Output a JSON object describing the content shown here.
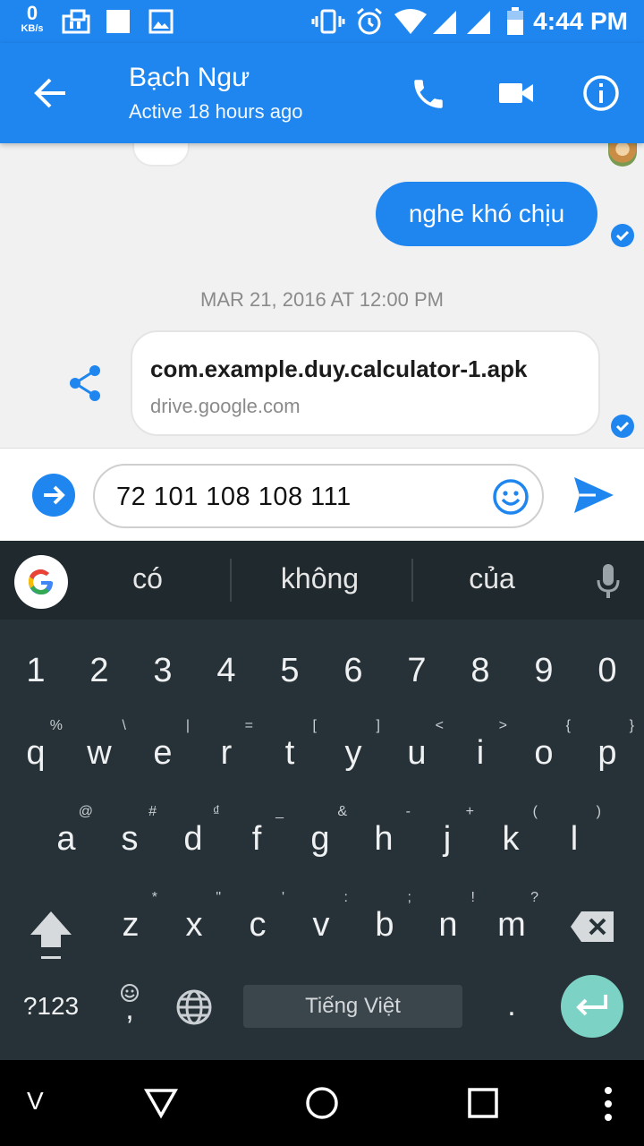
{
  "status_bar": {
    "speed_value": "0",
    "speed_unit": "KB/s",
    "time": "4:44 PM"
  },
  "app_bar": {
    "contact_name": "Bạch Ngư",
    "presence": "Active 18 hours ago"
  },
  "messages": {
    "outgoing_text": "nghe khó chịu",
    "timestamp": "MAR 21, 2016 AT 12:00 PM",
    "link_card": {
      "title": "com.example.duy.calculator-1.apk",
      "domain": "drive.google.com"
    }
  },
  "composer": {
    "input_value": "72 101 108 108 111"
  },
  "keyboard": {
    "suggestions": [
      "có",
      "không",
      "của"
    ],
    "number_row": [
      "1",
      "2",
      "3",
      "4",
      "5",
      "6",
      "7",
      "8",
      "9",
      "0"
    ],
    "row1": [
      {
        "k": "q",
        "h": "%"
      },
      {
        "k": "w",
        "h": "\\"
      },
      {
        "k": "e",
        "h": "|"
      },
      {
        "k": "r",
        "h": "="
      },
      {
        "k": "t",
        "h": "["
      },
      {
        "k": "y",
        "h": "]"
      },
      {
        "k": "u",
        "h": "<"
      },
      {
        "k": "i",
        "h": ">"
      },
      {
        "k": "o",
        "h": "{"
      },
      {
        "k": "p",
        "h": "}"
      }
    ],
    "row2": [
      {
        "k": "a",
        "h": "@"
      },
      {
        "k": "s",
        "h": "#"
      },
      {
        "k": "d",
        "h": "₫"
      },
      {
        "k": "f",
        "h": "_"
      },
      {
        "k": "g",
        "h": "&"
      },
      {
        "k": "h",
        "h": "-"
      },
      {
        "k": "j",
        "h": "+"
      },
      {
        "k": "k",
        "h": "("
      },
      {
        "k": "l",
        "h": ")"
      }
    ],
    "row3": [
      {
        "k": "z",
        "h": "*"
      },
      {
        "k": "x",
        "h": "\""
      },
      {
        "k": "c",
        "h": "'"
      },
      {
        "k": "v",
        "h": ":"
      },
      {
        "k": "b",
        "h": ";"
      },
      {
        "k": "n",
        "h": "!"
      },
      {
        "k": "m",
        "h": "?"
      }
    ],
    "symbols_label": "?123",
    "comma_label": ",",
    "period_label": ".",
    "space_label": "Tiếng Việt"
  },
  "nav_bar": {
    "left_label": "V"
  }
}
